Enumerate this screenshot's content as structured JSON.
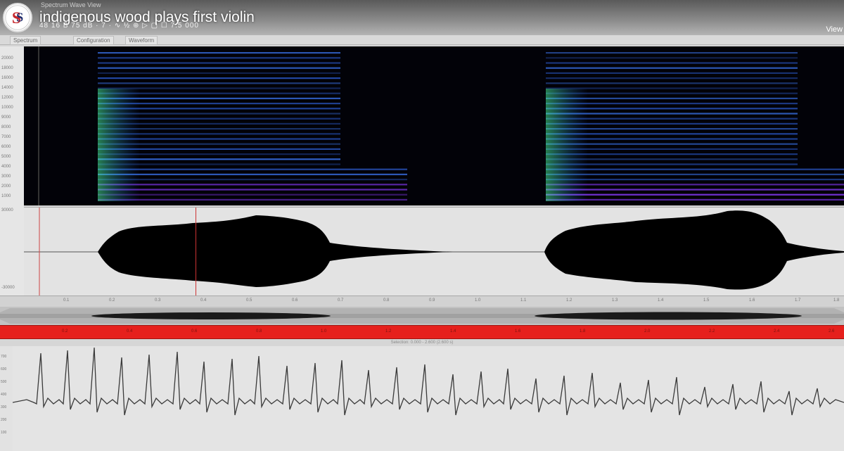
{
  "window": {
    "small_label": "Spectrum Wave View",
    "title": "indigenous wood plays first violin",
    "subline": "48 16 B 75 dB · 7 · ∿ ½ ⊕ ▷ ▢ ☐ 7.5 000",
    "view_label": "View"
  },
  "toolbar": {
    "items": [
      "Spectrum",
      "Configuration",
      "Waveform"
    ]
  },
  "spectrogram": {
    "y_ticks": [
      "20000",
      "18000",
      "16000",
      "14000",
      "12000",
      "10000",
      "9000",
      "8000",
      "7000",
      "6000",
      "5000",
      "4000",
      "3000",
      "2000",
      "1000"
    ]
  },
  "waveform": {
    "top_label": "30000",
    "bottom_label": "-30000"
  },
  "ruler": {
    "ticks": [
      "0.1",
      "0.2",
      "0.3",
      "0.4",
      "0.5",
      "0.6",
      "0.7",
      "0.8",
      "0.9",
      "1.0",
      "1.1",
      "1.2",
      "1.3",
      "1.4",
      "1.5",
      "1.6",
      "1.7",
      "1.8"
    ]
  },
  "red_bar": {
    "ticks": [
      "0.2",
      "0.4",
      "0.6",
      "0.8",
      "1.0",
      "1.2",
      "1.4",
      "1.6",
      "1.8",
      "2.0",
      "2.2",
      "2.4",
      "2.6"
    ]
  },
  "status": {
    "text": "Selection: 0.000 - 2.600 (2.600 s)"
  },
  "graph": {
    "y_ticks": [
      "700",
      "600",
      "500",
      "400",
      "300",
      "200",
      "100"
    ]
  },
  "colors": {
    "accent_red": "#e6201c",
    "spectrogram_bg": "#020208",
    "wave_fill": "#000000"
  }
}
